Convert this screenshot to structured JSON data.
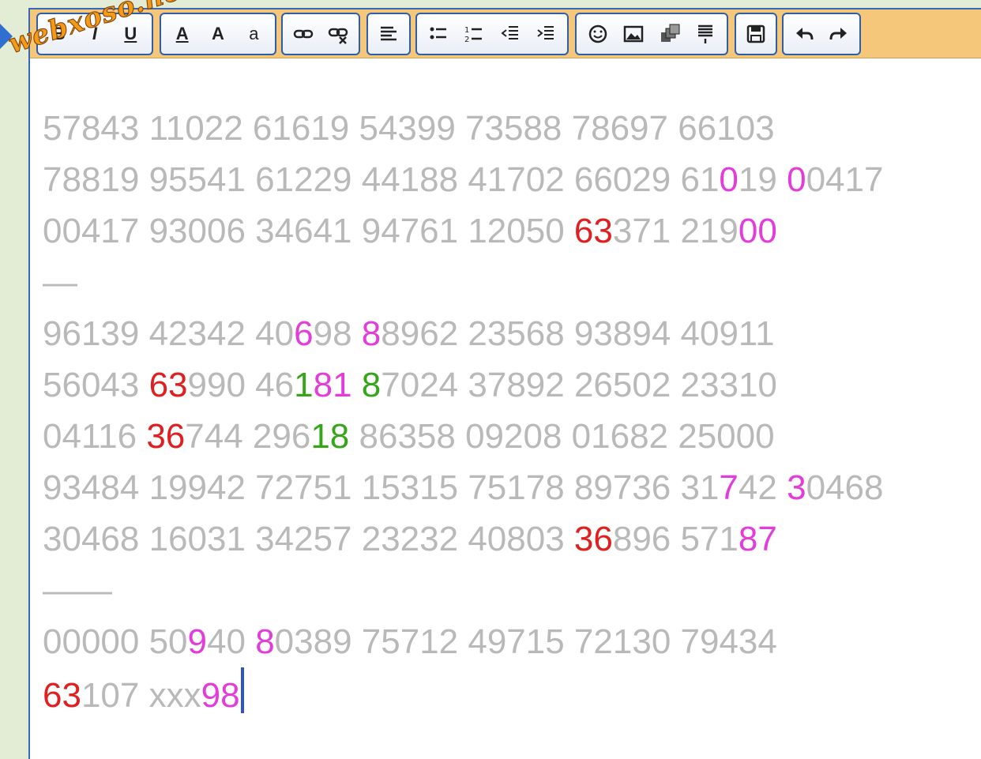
{
  "watermark": "webxoso.net",
  "toolbar": {
    "groups": [
      {
        "name": "text-style",
        "buttons": [
          {
            "label": "B",
            "icon": "bold-icon"
          },
          {
            "label": "I",
            "icon": "italic-icon"
          },
          {
            "label": "U",
            "icon": "underline-icon"
          }
        ]
      },
      {
        "name": "font",
        "buttons": [
          {
            "label": "A",
            "icon": "font-color-icon"
          },
          {
            "label": "A",
            "icon": "font-size-icon"
          },
          {
            "label": "a",
            "icon": "character-map-icon"
          }
        ]
      },
      {
        "name": "links",
        "buttons": [
          {
            "icon": "link-icon"
          },
          {
            "icon": "unlink-icon"
          }
        ]
      },
      {
        "name": "align",
        "buttons": [
          {
            "icon": "align-left-icon"
          }
        ]
      },
      {
        "name": "lists",
        "buttons": [
          {
            "icon": "bullet-list-icon"
          },
          {
            "icon": "numbered-list-icon"
          },
          {
            "icon": "outdent-icon"
          },
          {
            "icon": "indent-icon"
          }
        ]
      },
      {
        "name": "insert",
        "buttons": [
          {
            "icon": "emoticon-icon"
          },
          {
            "icon": "image-icon"
          },
          {
            "icon": "copy-icon"
          },
          {
            "icon": "page-break-icon"
          }
        ]
      },
      {
        "name": "save",
        "buttons": [
          {
            "icon": "save-icon"
          }
        ]
      },
      {
        "name": "history",
        "buttons": [
          {
            "icon": "undo-icon"
          },
          {
            "icon": "redo-icon"
          }
        ]
      }
    ]
  },
  "colors": {
    "plain": "#b9b9b9",
    "red": "#e02020",
    "magenta": "#e33cdb",
    "green": "#36a51a",
    "caret": "#2f55c4"
  },
  "content": [
    [
      [
        "57843 11022 61619 54399 73588 78697 66103",
        "p"
      ]
    ],
    [
      [
        "78819 95541 61229 44188 41702 66029 61",
        "p"
      ],
      [
        "0",
        "m"
      ],
      [
        "19 ",
        "p"
      ],
      [
        "0",
        "m"
      ],
      [
        "0417",
        "p"
      ]
    ],
    [
      [
        "00417 93006 34641 94761 12050 ",
        "p"
      ],
      [
        "63",
        "r"
      ],
      [
        "371 219",
        "p"
      ],
      [
        "00",
        "m"
      ]
    ],
    [
      [
        "—",
        "p"
      ]
    ],
    [
      [
        "96139 42342 40",
        "p"
      ],
      [
        "6",
        "m"
      ],
      [
        "98 ",
        "p"
      ],
      [
        "8",
        "m"
      ],
      [
        "8962 23568 93894 40911",
        "p"
      ]
    ],
    [
      [
        "56043 ",
        "p"
      ],
      [
        "63",
        "r"
      ],
      [
        "990 46",
        "p"
      ],
      [
        "1",
        "g"
      ],
      [
        "81",
        "m"
      ],
      [
        " ",
        "p"
      ],
      [
        "8",
        "g"
      ],
      [
        "7024 37892 26502 23310",
        "p"
      ]
    ],
    [
      [
        "04116 ",
        "p"
      ],
      [
        "36",
        "r"
      ],
      [
        "744 296",
        "p"
      ],
      [
        "18",
        "g"
      ],
      [
        " 86358 09208 01682 25000",
        "p"
      ]
    ],
    [
      [
        "93484 19942 72751 15315 75178 89736 31",
        "p"
      ],
      [
        "7",
        "m"
      ],
      [
        "42 ",
        "p"
      ],
      [
        "3",
        "m"
      ],
      [
        "0468",
        "p"
      ]
    ],
    [
      [
        "30468 16031 34257 23232 40803 ",
        "p"
      ],
      [
        "36",
        "r"
      ],
      [
        "896 571",
        "p"
      ],
      [
        "87",
        "m"
      ]
    ],
    [
      [
        "——",
        "p"
      ]
    ],
    [
      [
        "00000 50",
        "p"
      ],
      [
        "9",
        "m"
      ],
      [
        "40 ",
        "p"
      ],
      [
        "8",
        "m"
      ],
      [
        "0389 75712 49715 72130 79434",
        "p"
      ]
    ],
    [
      [
        "63",
        "r"
      ],
      [
        "107 xxx",
        "p"
      ],
      [
        "98",
        "m"
      ]
    ]
  ]
}
